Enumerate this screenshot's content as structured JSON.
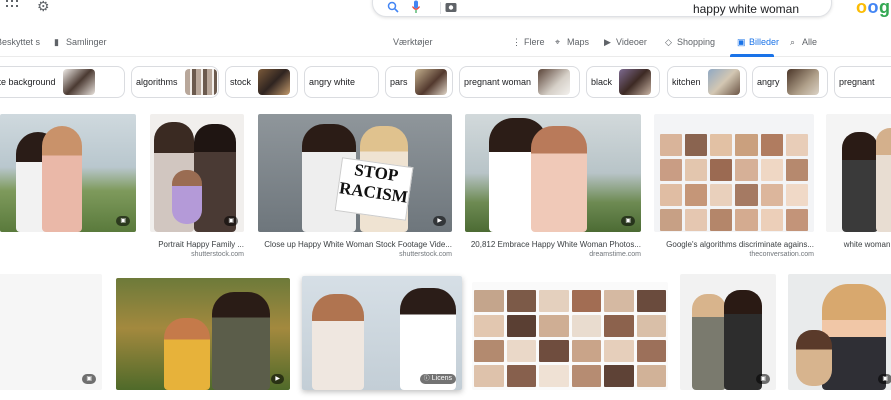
{
  "header": {
    "query": "happy white woman",
    "logo": "oogle",
    "icons": [
      "apps-icon",
      "settings-gear-icon",
      "search-icon",
      "mic-icon",
      "image-search-icon"
    ]
  },
  "tabs": [
    {
      "label": "Alle",
      "icon": "search-icon"
    },
    {
      "label": "Billeder",
      "icon": "image-icon",
      "active": true
    },
    {
      "label": "Shopping",
      "icon": "tag-icon"
    },
    {
      "label": "Videoer",
      "icon": "video-icon"
    },
    {
      "label": "Maps",
      "icon": "pin-icon"
    },
    {
      "label": "Flere",
      "icon": "more-icon"
    },
    {
      "label": "Værktøjer"
    },
    {
      "label": "Samlinger",
      "icon": "bookmark-icon"
    },
    {
      "label": "Beskyttet s"
    }
  ],
  "chips": [
    {
      "label": "pregnant"
    },
    {
      "label": "angry"
    },
    {
      "label": "kitchen"
    },
    {
      "label": "black"
    },
    {
      "label": "pregnant woman"
    },
    {
      "label": "pars"
    },
    {
      "label": "angry white"
    },
    {
      "label": "stock"
    },
    {
      "label": "algorithms"
    },
    {
      "label": "white background"
    }
  ],
  "results": [
    {
      "title": "Google's algorithms discriminate agains...",
      "source": "theconversation.com",
      "badge": ""
    },
    {
      "title": "20,812 Embrace Happy White Woman Photos...",
      "source": "dreamstime.com",
      "badge": ""
    },
    {
      "title": "Close up Happy White Woman Stock Footage Vide...",
      "source": "shutterstock.com",
      "badge": "",
      "sign": "STOP RACISM"
    },
    {
      "title": "Portrait Happy Family ...",
      "source": "shutterstock.com",
      "badge": ""
    },
    {
      "title": "20,812 Embrace Happy White Woman ...",
      "source": "dreamstime.com",
      "badge": ""
    },
    {
      "title": "white woman pr...",
      "source": "",
      "badge": ""
    },
    {
      "title": "",
      "source": "",
      "badge": "Licens"
    }
  ],
  "colors": {
    "accent": "#1a73e8",
    "text": "#202124",
    "muted": "#70757a"
  }
}
